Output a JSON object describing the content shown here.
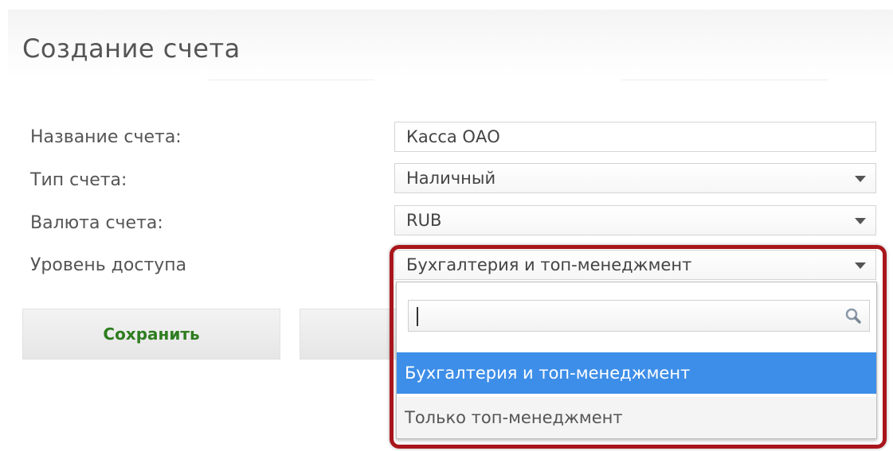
{
  "header": {
    "title": "Создание счета"
  },
  "form": {
    "name_label": "Название счета:",
    "name_value": "Касса ОАО",
    "type_label": "Тип счета:",
    "type_value": "Наличный",
    "currency_label": "Валюта счета:",
    "currency_value": "RUB",
    "access_label": "Уровень доступа",
    "access_value": "Бухгалтерия и топ-менеджмент"
  },
  "buttons": {
    "save_label": "Сохранить",
    "cancel_label": ""
  },
  "dropdown": {
    "search_value": "",
    "options": [
      {
        "label": "Бухгалтерия и топ-менеджмент",
        "selected": true
      },
      {
        "label": "Только топ-менеджмент",
        "selected": false
      }
    ]
  },
  "colors": {
    "highlight_border": "#a8161b",
    "selected_option_bg": "#3d8ee8",
    "save_text": "#2e7d1f"
  },
  "icons": {
    "caret": "chevron-down-icon",
    "search": "search-icon"
  }
}
